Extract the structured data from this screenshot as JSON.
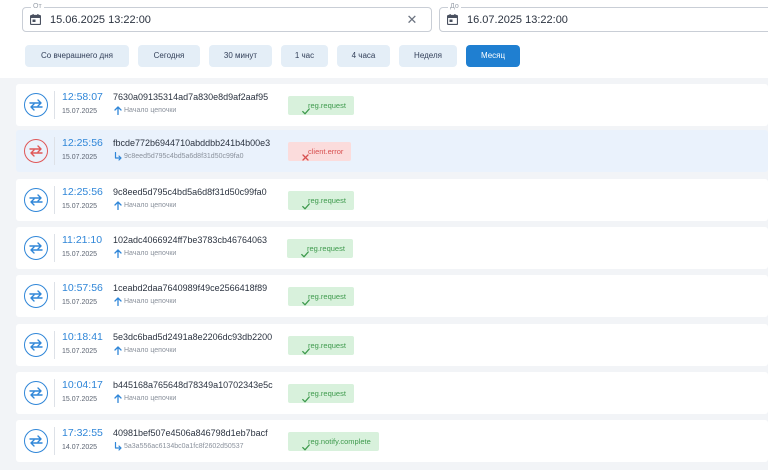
{
  "filters": {
    "from": {
      "legend": "От",
      "value": "15.06.2025 13:22:00",
      "clear_icon": "✕"
    },
    "to": {
      "legend": "До",
      "value": "16.07.2025 13:22:00"
    }
  },
  "presets": [
    {
      "label": "Со вчерашнего дня",
      "active": false
    },
    {
      "label": "Сегодня",
      "active": false
    },
    {
      "label": "30 минут",
      "active": false
    },
    {
      "label": "1 час",
      "active": false
    },
    {
      "label": "4 часа",
      "active": false
    },
    {
      "label": "Неделя",
      "active": false
    },
    {
      "label": "Месяц",
      "active": true
    }
  ],
  "colors": {
    "accent": "#1f7fd1",
    "success_bg": "#d8f1dc",
    "success_text": "#3e9a4d",
    "error_bg": "#fbdcdc",
    "error_text": "#d74f4f"
  },
  "icons": {
    "calendar": "calendar-icon",
    "clear": "close-icon",
    "exchange": "exchange-arrows-icon",
    "chain_start": "arrow-up-icon",
    "chain_child": "corner-down-right-icon",
    "tag_ok": "check-icon",
    "tag_err": "x-icon"
  },
  "events": [
    {
      "time": "12:58:07",
      "date": "15.07.2025",
      "hash": "7630a09135314ad7a830e8d9af2aaf95",
      "sub": "Начало цепочки",
      "sub_kind": "start",
      "tag": "reg.request",
      "status": "ok"
    },
    {
      "time": "12:25:56",
      "date": "15.07.2025",
      "hash": "fbcde772b6944710abddbb241b4b00e3",
      "sub": "9c8eed5d795c4bd5a6d8f31d50c99fa0",
      "sub_kind": "child",
      "tag": "client.error",
      "status": "error"
    },
    {
      "time": "12:25:56",
      "date": "15.07.2025",
      "hash": "9c8eed5d795c4bd5a6d8f31d50c99fa0",
      "sub": "Начало цепочки",
      "sub_kind": "start",
      "tag": "reg.request",
      "status": "ok"
    },
    {
      "time": "11:21:10",
      "date": "15.07.2025",
      "hash": "102adc4066924ff7be3783cb46764063",
      "sub": "Начало цепочки",
      "sub_kind": "start",
      "tag": "reg.request",
      "status": "ok"
    },
    {
      "time": "10:57:56",
      "date": "15.07.2025",
      "hash": "1ceabd2daa7640989f49ce2566418f89",
      "sub": "Начало цепочки",
      "sub_kind": "start",
      "tag": "reg.request",
      "status": "ok"
    },
    {
      "time": "10:18:41",
      "date": "15.07.2025",
      "hash": "5e3dc6bad5d2491a8e2206dc93db2200",
      "sub": "Начало цепочки",
      "sub_kind": "start",
      "tag": "reg.request",
      "status": "ok"
    },
    {
      "time": "10:04:17",
      "date": "15.07.2025",
      "hash": "b445168a765648d78349a10702343e5c",
      "sub": "Начало цепочки",
      "sub_kind": "start",
      "tag": "reg.request",
      "status": "ok"
    },
    {
      "time": "17:32:55",
      "date": "14.07.2025",
      "hash": "40981bef507e4506a846798d1eb7bacf",
      "sub": "5a3a556ac6134bc0a1fc8f2602d50537",
      "sub_kind": "child",
      "tag": "reg.notify.complete",
      "status": "ok"
    }
  ]
}
